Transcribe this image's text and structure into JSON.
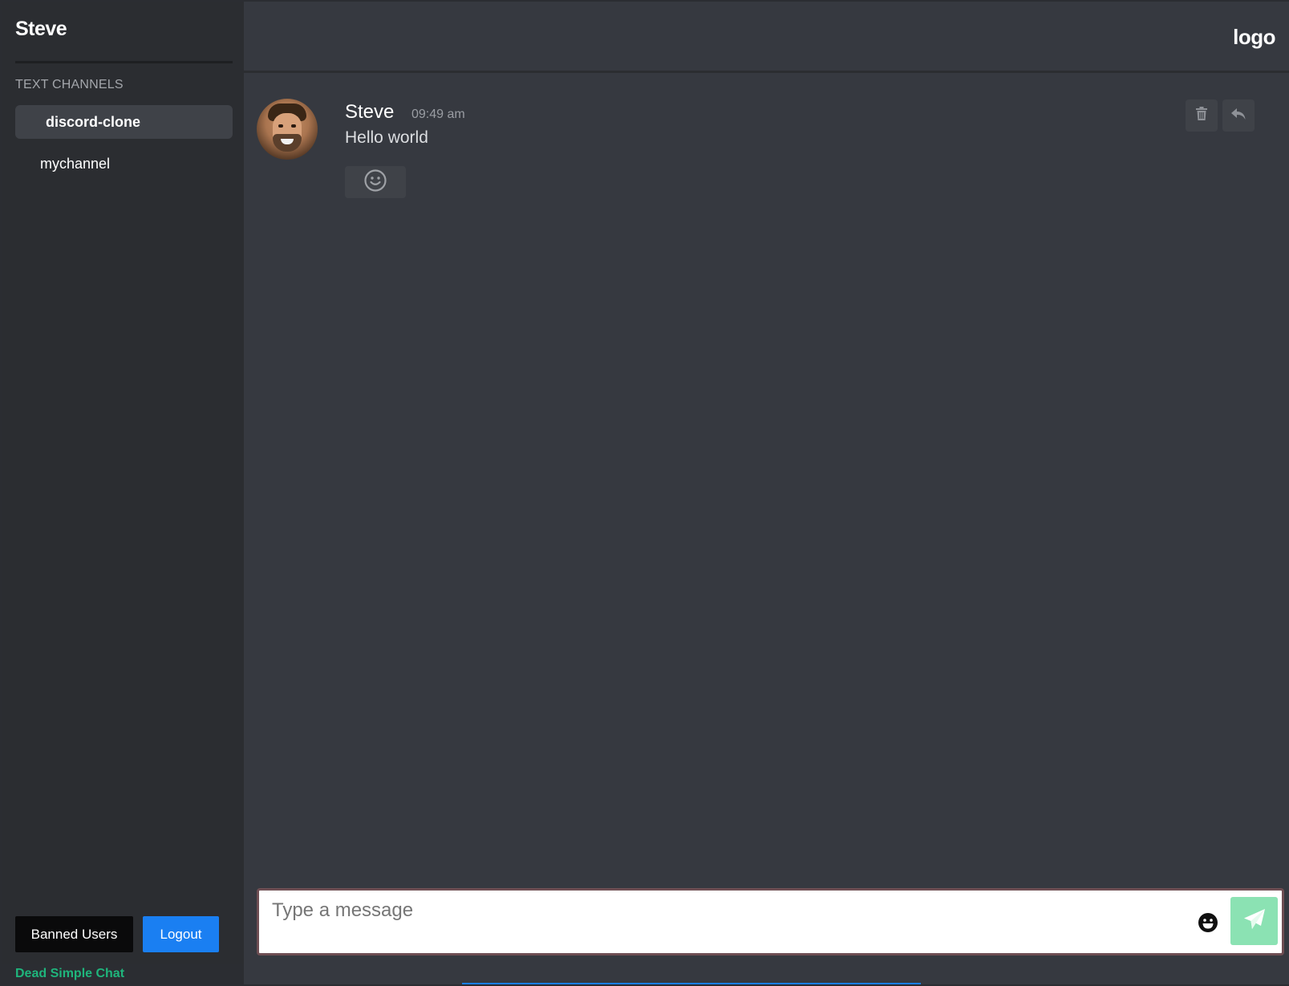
{
  "sidebar": {
    "user_name": "Steve",
    "section_heading": "TEXT CHANNELS",
    "channels": [
      {
        "label": "discord-clone",
        "active": true
      },
      {
        "label": "mychannel",
        "active": false
      }
    ],
    "banned_users_label": "Banned Users",
    "logout_label": "Logout",
    "branding": "Dead Simple Chat"
  },
  "header": {
    "logo": "logo"
  },
  "messages": [
    {
      "author": "Steve",
      "time": "09:49 am",
      "text": "Hello world",
      "reaction_icon": "smile-outline-icon",
      "actions": [
        "trash-icon",
        "reply-icon"
      ]
    }
  ],
  "composer": {
    "placeholder": "Type a message",
    "value": "",
    "emoji_icon": "emoji-icon",
    "send_icon": "send-icon"
  },
  "colors": {
    "sidebar_bg": "#2b2d31",
    "main_bg": "#363940",
    "active_channel_bg": "#3f4248",
    "logout_button": "#1a7ff2",
    "banned_button": "#0a0a0b",
    "branding": "#1fb57c",
    "send_button": "#8be2b3",
    "composer_border": "#6e4e53"
  }
}
